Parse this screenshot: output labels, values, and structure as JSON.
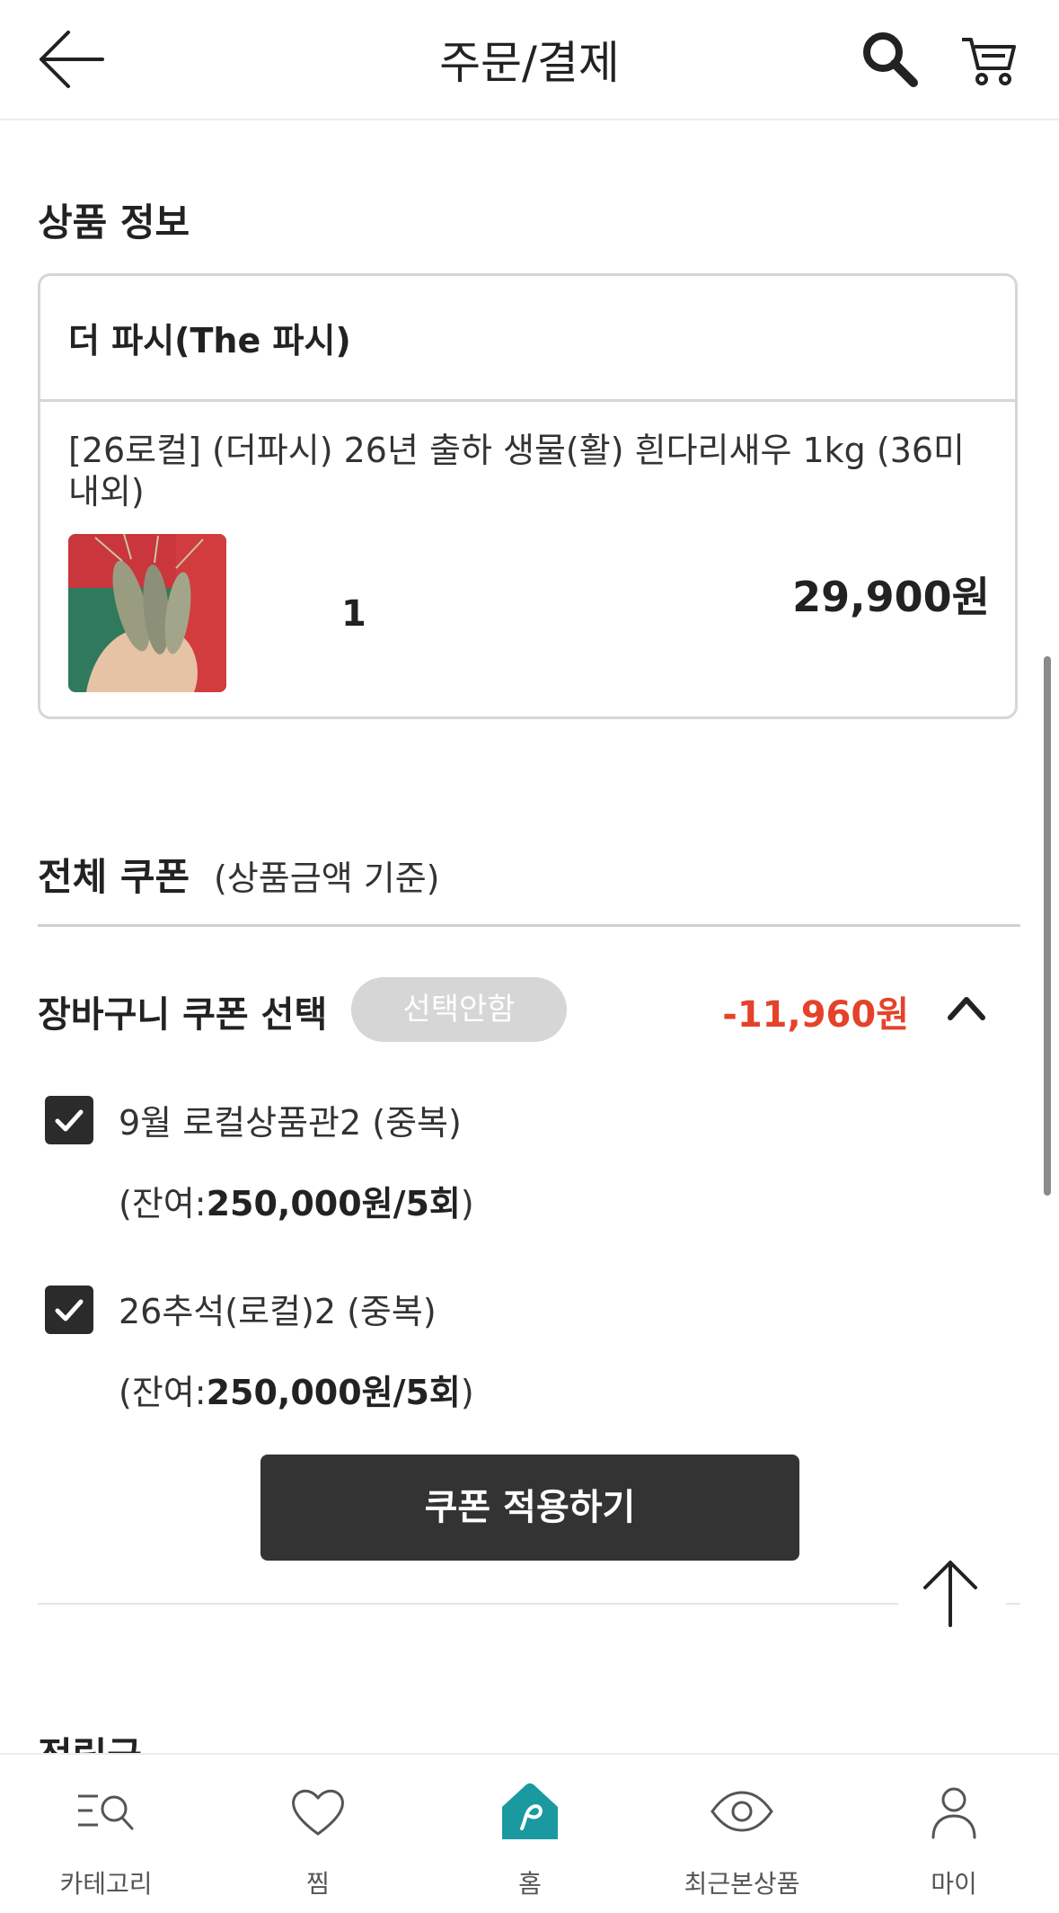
{
  "header": {
    "title": "주문/결제"
  },
  "product_section": {
    "title": "상품 정보",
    "seller": "더 파시(The 파시)",
    "product_name": "[26로컬] (더파시) 26년 출하 생물(활) 흰다리새우 1kg (36미 내외)",
    "quantity": "1",
    "price": "29,900원"
  },
  "coupon_section": {
    "title": "전체 쿠폰",
    "subtitle": "(상품금액 기준)",
    "cart_coupon_label": "장바구니 쿠폰 선택",
    "no_select_label": "선택안함",
    "discount": "-11,960원",
    "options": [
      {
        "label": "9월 로컬상품관2 (중복)",
        "remain_prefix": "(잔여:",
        "remain_value": "250,000원/5회",
        "remain_suffix": ")",
        "checked": true
      },
      {
        "label": "26추석(로컬)2 (중복)",
        "remain_prefix": "(잔여:",
        "remain_value": "250,000원/5회",
        "remain_suffix": ")",
        "checked": true
      }
    ],
    "apply_button": "쿠폰 적용하기"
  },
  "next_section_peek": "적립금",
  "bottom_nav": {
    "items": [
      {
        "label": "카테고리",
        "icon": "category-search-icon"
      },
      {
        "label": "찜",
        "icon": "heart-icon"
      },
      {
        "label": "홈",
        "icon": "home-icon",
        "active": true
      },
      {
        "label": "최근본상품",
        "icon": "eye-icon"
      },
      {
        "label": "마이",
        "icon": "person-icon"
      }
    ]
  },
  "colors": {
    "accent_home": "#1a9aa0",
    "discount": "#e5422b",
    "button_dark": "#333333",
    "pill_gray": "#d6d6d6"
  }
}
